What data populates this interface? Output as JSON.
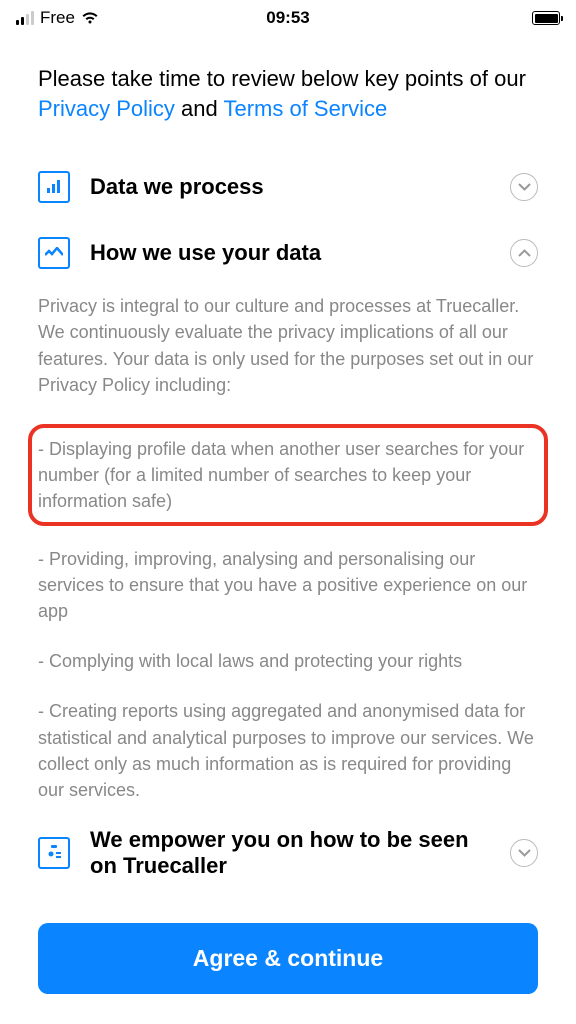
{
  "status": {
    "carrier": "Free",
    "time": "09:53"
  },
  "intro": {
    "prefix": "Please take time to review below key points of our ",
    "link1": "Privacy Policy",
    "middle": " and ",
    "link2": "Terms of Service"
  },
  "sections": {
    "data_process": {
      "title": "Data we process"
    },
    "how_use": {
      "title": "How we use your data",
      "body": "Privacy is integral to our culture and processes at Truecaller. We continuously evaluate the privacy implications of all our features. Your data is only used for the purposes set out in our Privacy Policy including:",
      "bullets": [
        "- Displaying profile data when another user searches for your number (for a limited number of searches to keep your information safe)",
        "- Providing, improving, analysing and personalising our services to ensure that you have a positive experience on our app",
        "- Complying with local laws and protecting your rights",
        "- Creating reports using aggregated and anonymised data for statistical and analytical purposes to improve our services. We collect only as much information as is required for providing our services."
      ]
    },
    "empower": {
      "title": "We empower you on how to be seen on Truecaller"
    }
  },
  "cta": {
    "label": "Agree & continue"
  }
}
